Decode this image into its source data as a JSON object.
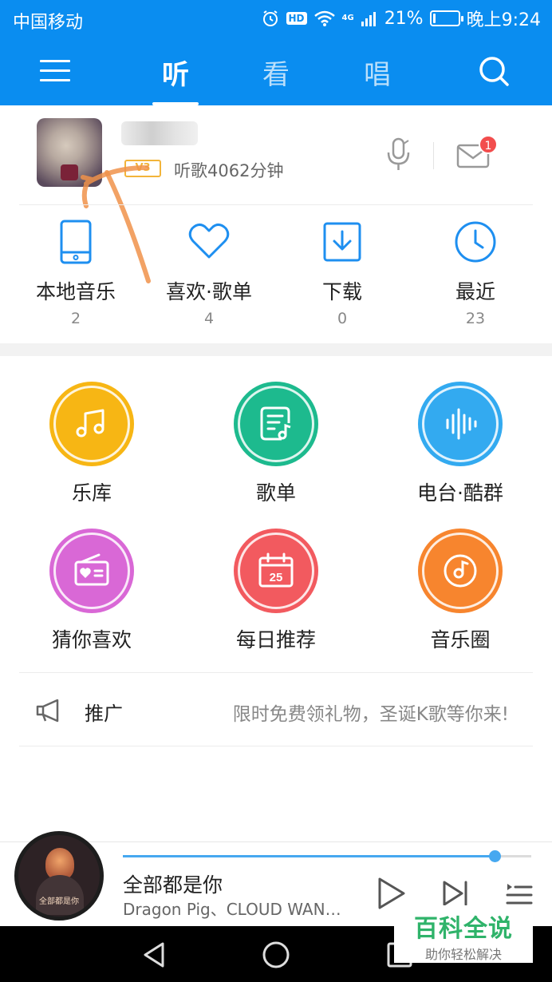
{
  "status_bar": {
    "carrier": "中国移动",
    "network": "4G",
    "battery": "21%",
    "battery_level": 0.21,
    "time": "晚上9:24"
  },
  "nav": {
    "tabs": [
      {
        "label": "听",
        "active": true
      },
      {
        "label": "看",
        "active": false
      },
      {
        "label": "唱",
        "active": false
      }
    ]
  },
  "user": {
    "level": "V3",
    "listen_time": "听歌4062分钟",
    "unread_messages": "1"
  },
  "quick_access": [
    {
      "label": "本地音乐",
      "count": "2",
      "icon": "phone-icon"
    },
    {
      "label": "喜欢·歌单",
      "count": "4",
      "icon": "heart-icon"
    },
    {
      "label": "下载",
      "count": "0",
      "icon": "download-icon"
    },
    {
      "label": "最近",
      "count": "23",
      "icon": "clock-icon"
    }
  ],
  "features": [
    {
      "label": "乐库",
      "icon": "music-note-icon",
      "color": "#f7b614"
    },
    {
      "label": "歌单",
      "icon": "playlist-icon",
      "color": "#1dba8e"
    },
    {
      "label": "电台·酷群",
      "icon": "soundwave-icon",
      "color": "#33aaf0"
    },
    {
      "label": "猜你喜欢",
      "icon": "radio-heart-icon",
      "color": "#d968d6"
    },
    {
      "label": "每日推荐",
      "icon": "calendar-icon",
      "color": "#f25a5f",
      "calendar_day": "25"
    },
    {
      "label": "音乐圈",
      "icon": "disc-icon",
      "color": "#f7852e"
    }
  ],
  "promo": {
    "title": "推广",
    "text": "限时免费领礼物，圣诞K歌等你来!"
  },
  "player": {
    "song_title": "全部都是你",
    "artist": "Dragon Pig、CLOUD WAN…",
    "cover_text": "全部都是你",
    "progress": 0.91
  },
  "colors": {
    "brand_blue": "#0a8df0",
    "progress_blue": "#46a8f0",
    "badge_red": "#f24d4d"
  },
  "watermark": {
    "title": "百科全说",
    "subtitle": "助你轻松解决"
  }
}
